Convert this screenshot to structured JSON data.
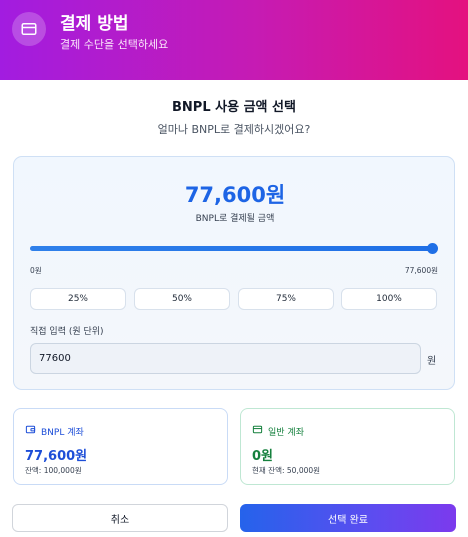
{
  "header": {
    "title": "결제 방법",
    "subtitle": "결제 수단을 선택하세요",
    "icon": "credit-card-icon"
  },
  "section": {
    "title": "BNPL 사용 금액 선택",
    "subtitle": "얼마나 BNPL로 결제하시겠어요?"
  },
  "amount": {
    "value_text": "77,600원",
    "caption": "BNPL로 결제될 금액"
  },
  "slider": {
    "min_label": "0원",
    "max_label": "77,600원",
    "value": 77600,
    "max": 77600,
    "accent": "#1f6fe6"
  },
  "presets": [
    "25%",
    "50%",
    "75%",
    "100%"
  ],
  "direct_input": {
    "label": "직접 입력 (원 단위)",
    "value": "77600",
    "unit": "원"
  },
  "bnpl_account": {
    "title": "BNPL 계좌",
    "amount": "77,600원",
    "balance": "잔액: 100,000원",
    "color": "#1d4ed8"
  },
  "regular_account": {
    "title": "일반 계좌",
    "amount": "0원",
    "balance": "현재 잔액: 50,000원",
    "color": "#15803d"
  },
  "buttons": {
    "cancel": "취소",
    "confirm": "선택 완료"
  }
}
